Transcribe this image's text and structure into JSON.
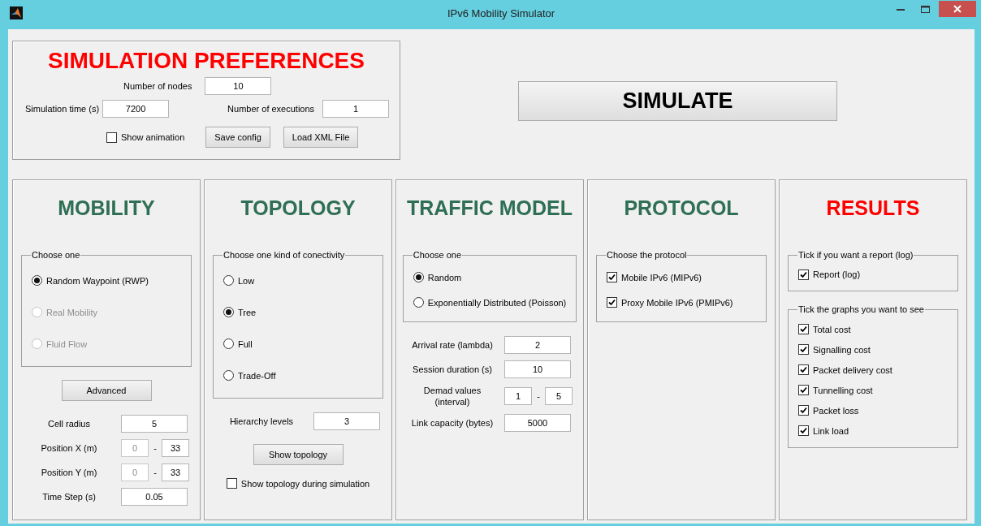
{
  "window": {
    "title": "IPv6 Mobility Simulator"
  },
  "preferences": {
    "title": "SIMULATION PREFERENCES",
    "nodes": {
      "label": "Number of nodes",
      "value": "10"
    },
    "time": {
      "label": "Simulation time (s)",
      "value": "7200"
    },
    "executions": {
      "label": "Number of executions",
      "value": "1"
    },
    "show_animation": {
      "label": "Show animation",
      "checked": false
    },
    "buttons": [
      "Save config",
      "Load XML File"
    ]
  },
  "simulate_button": "SIMULATE",
  "panels": [
    {
      "title": "MOBILITY",
      "color": "#2f6f55",
      "sections": [
        {
          "kind": "group",
          "legend": "Choose one",
          "options": [
            {
              "kind": "radio",
              "label": "Random Waypoint (RWP)",
              "selected": true,
              "disabled": false
            },
            {
              "kind": "radio",
              "label": "Real Mobility",
              "selected": false,
              "disabled": true
            },
            {
              "kind": "radio",
              "label": "Fluid Flow",
              "selected": false,
              "disabled": true
            }
          ]
        },
        {
          "kind": "button",
          "label": "Advanced"
        },
        {
          "kind": "fields",
          "items": [
            {
              "kind": "single",
              "label": "Cell radius",
              "value": "5"
            },
            {
              "kind": "range",
              "label": "Position X (m)",
              "from": "0",
              "from_disabled": true,
              "separator": "-",
              "to": "33"
            },
            {
              "kind": "range",
              "label": "Position Y (m)",
              "from": "0",
              "from_disabled": true,
              "separator": "-",
              "to": "33"
            },
            {
              "kind": "single",
              "label": "Time Step (s)",
              "value": "0.05"
            }
          ]
        }
      ]
    },
    {
      "title": "TOPOLOGY",
      "color": "#2f6f55",
      "sections": [
        {
          "kind": "group",
          "legend": "Choose one kind of conectivity",
          "options": [
            {
              "kind": "radio",
              "label": "Low",
              "selected": false,
              "disabled": false
            },
            {
              "kind": "radio",
              "label": "Tree",
              "selected": true,
              "disabled": false
            },
            {
              "kind": "radio",
              "label": "Full",
              "selected": false,
              "disabled": false
            },
            {
              "kind": "radio",
              "label": "Trade-Off",
              "selected": false,
              "disabled": false
            }
          ]
        },
        {
          "kind": "fields",
          "items": [
            {
              "kind": "single",
              "label": "Hierarchy levels",
              "value": "3"
            }
          ]
        },
        {
          "kind": "button",
          "label": "Show topology"
        },
        {
          "kind": "checkbox",
          "label": "Show topology during simulation",
          "checked": false
        }
      ]
    },
    {
      "title": "TRAFFIC MODEL",
      "color": "#2f6f55",
      "sections": [
        {
          "kind": "group",
          "legend": "Choose one",
          "options": [
            {
              "kind": "radio",
              "label": "Random",
              "selected": true,
              "disabled": false
            },
            {
              "kind": "radio",
              "label": "Exponentially Distributed (Poisson)",
              "selected": false,
              "disabled": false
            }
          ]
        },
        {
          "kind": "fields",
          "items": [
            {
              "kind": "single",
              "label": "Arrival rate (lambda)",
              "value": "2"
            },
            {
              "kind": "single",
              "label": "Session duration (s)",
              "value": "10"
            },
            {
              "kind": "range",
              "label": "Demad values\n(interval)",
              "from": "1",
              "from_disabled": false,
              "separator": "-",
              "to": "5"
            },
            {
              "kind": "single",
              "label": "Link capacity (bytes)",
              "value": "5000"
            }
          ]
        }
      ]
    },
    {
      "title": "PROTOCOL",
      "color": "#2f6f55",
      "sections": [
        {
          "kind": "group",
          "legend": "Choose the protocol",
          "options": [
            {
              "kind": "check",
              "label": "Mobile IPv6 (MIPv6)",
              "checked": true
            },
            {
              "kind": "check",
              "label": "Proxy Mobile IPv6 (PMIPv6)",
              "checked": true
            }
          ]
        }
      ]
    },
    {
      "title": "RESULTS",
      "color": "#ff0000",
      "sections": [
        {
          "kind": "group",
          "legend": "Tick if you want a report (log)",
          "options": [
            {
              "kind": "check",
              "label": "Report (log)",
              "checked": true
            }
          ]
        },
        {
          "kind": "group",
          "legend": "Tick the graphs you want to see",
          "options": [
            {
              "kind": "check",
              "label": "Total cost",
              "checked": true
            },
            {
              "kind": "check",
              "label": "Signalling cost",
              "checked": true
            },
            {
              "kind": "check",
              "label": "Packet delivery cost",
              "checked": true
            },
            {
              "kind": "check",
              "label": "Tunnelling cost",
              "checked": true
            },
            {
              "kind": "check",
              "label": "Packet loss",
              "checked": true
            },
            {
              "kind": "check",
              "label": "Link load",
              "checked": true
            }
          ]
        }
      ]
    }
  ]
}
